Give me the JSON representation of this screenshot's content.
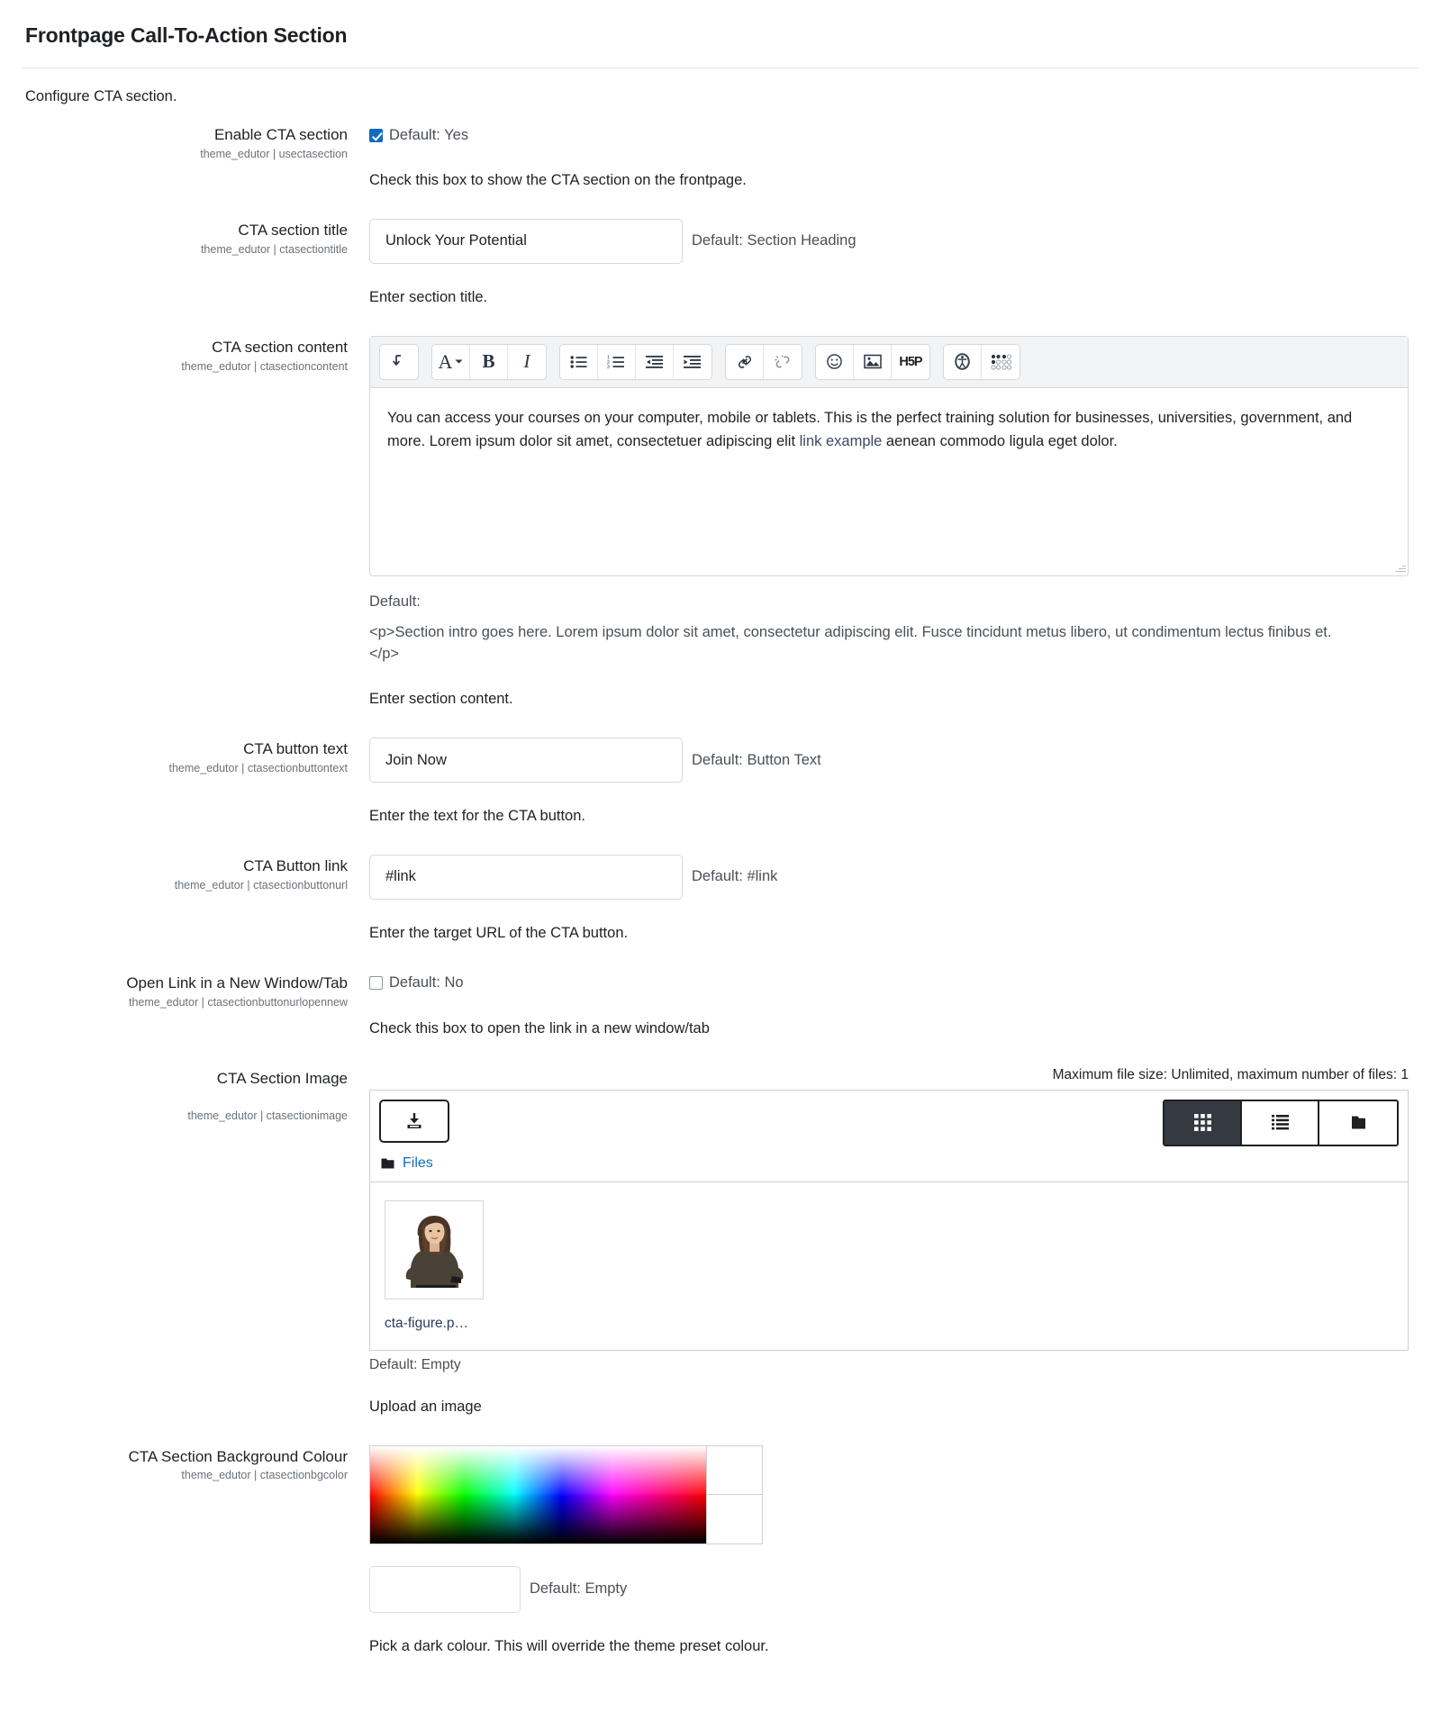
{
  "page": {
    "title": "Frontpage Call-To-Action Section",
    "intro": "Configure CTA section."
  },
  "fields": {
    "enable": {
      "label": "Enable CTA section",
      "sublabel": "theme_edutor | usectasection",
      "checked": true,
      "default_text": "Default: Yes",
      "help": "Check this box to show the CTA section on the frontpage."
    },
    "title": {
      "label": "CTA section title",
      "sublabel": "theme_edutor | ctasectiontitle",
      "value": "Unlock Your Potential",
      "placeholder": "",
      "default_text": "Default: Section Heading",
      "help": "Enter section title."
    },
    "content": {
      "label": "CTA section content",
      "sublabel": "theme_edutor | ctasectioncontent",
      "body_part1": "You can access your courses on your computer, mobile or tablets. This is the perfect training solution for businesses, universities, government, and more. Lorem ipsum dolor sit amet, consectetuer adipiscing elit ",
      "body_link": "link example",
      "body_part2": " aenean commodo ligula eget dolor.",
      "default_label": "Default:",
      "default_value": "<p>Section intro goes here. Lorem ipsum dolor sit amet, consectetur adipiscing elit. Fusce tincidunt metus libero, ut condimentum lectus finibus et.</p>",
      "help": "Enter section content.",
      "toolbar": [
        {
          "name": "expand-collapse-icon",
          "label": "Expand/collapse toolbar"
        },
        {
          "name": "font-style-icon",
          "label": "Font style"
        },
        {
          "name": "bold-icon",
          "label": "Bold"
        },
        {
          "name": "italic-icon",
          "label": "Italic"
        },
        {
          "name": "bullet-list-icon",
          "label": "Bulleted list"
        },
        {
          "name": "numbered-list-icon",
          "label": "Numbered list"
        },
        {
          "name": "outdent-icon",
          "label": "Decrease indent"
        },
        {
          "name": "indent-icon",
          "label": "Increase indent"
        },
        {
          "name": "link-icon",
          "label": "Link"
        },
        {
          "name": "unlink-icon",
          "label": "Unlink"
        },
        {
          "name": "emoji-icon",
          "label": "Emoji"
        },
        {
          "name": "image-icon",
          "label": "Image"
        },
        {
          "name": "h5p-icon",
          "label": "H5P"
        },
        {
          "name": "accessibility-checker-icon",
          "label": "Accessibility checker"
        },
        {
          "name": "screenreader-helper-icon",
          "label": "Screenreader helper"
        }
      ]
    },
    "button_text": {
      "label": "CTA button text",
      "sublabel": "theme_edutor | ctasectionbuttontext",
      "value": "Join Now",
      "default_text": "Default: Button Text",
      "help": "Enter the text for the CTA button."
    },
    "button_link": {
      "label": "CTA Button link",
      "sublabel": "theme_edutor | ctasectionbuttonurl",
      "value": "#link",
      "default_text": "Default: #link",
      "help": "Enter the target URL of the CTA button."
    },
    "open_new": {
      "label": "Open Link in a New Window/Tab",
      "sublabel": "theme_edutor | ctasectionbuttonurlopennew",
      "checked": false,
      "default_text": "Default: No",
      "help": "Check this box to open the link in a new window/tab"
    },
    "image": {
      "label": "CTA Section Image",
      "sublabel": "theme_edutor | ctasectionimage",
      "max_info": "Maximum file size: Unlimited, maximum number of files: 1",
      "add_button": "add-file-button",
      "views": [
        {
          "name": "view-grid-button",
          "active": true
        },
        {
          "name": "view-list-button",
          "active": false
        },
        {
          "name": "view-tree-button",
          "active": false
        }
      ],
      "path_label": "Files",
      "file": {
        "name": "cta-figure.p…"
      },
      "default_text": "Default: Empty",
      "help": "Upload an image"
    },
    "bgcolor": {
      "label": "CTA Section Background Colour",
      "sublabel": "theme_edutor | ctasectionbgcolor",
      "value": "",
      "default_text": "Default: Empty",
      "help": "Pick a dark colour. This will override the theme preset colour."
    }
  },
  "colors": {
    "link": "#0f6cbf",
    "checkbox_accent": "#0f6cbf",
    "text": "#1d2125",
    "muted": "#6a737b",
    "border": "#d4d8dd",
    "toolbar_bg": "#f2f3f5",
    "active_view_bg": "#343a40"
  }
}
